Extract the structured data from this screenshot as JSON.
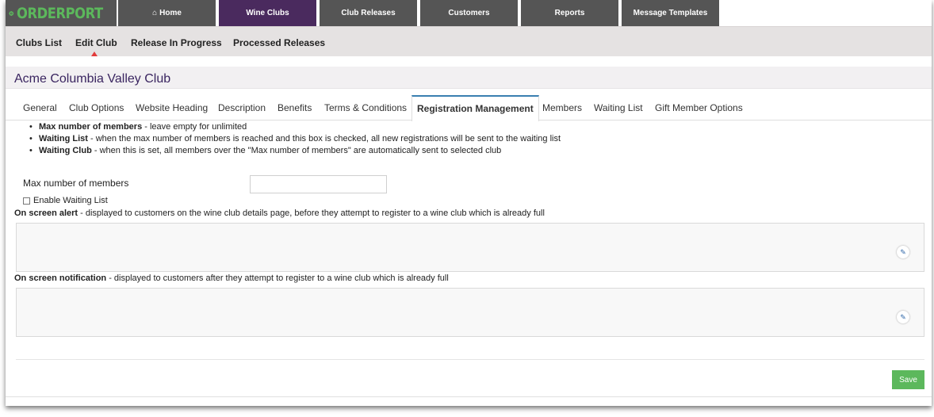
{
  "brand": {
    "name": "ORDERPORT",
    "logo_color": "#5cb85c"
  },
  "topnav": {
    "items": [
      {
        "label": "Home",
        "icon": "home-icon"
      },
      {
        "label": "Wine Clubs"
      },
      {
        "label": "Club Releases"
      },
      {
        "label": "Customers"
      },
      {
        "label": "Reports"
      },
      {
        "label": "Message Templates"
      }
    ],
    "active": "Wine Clubs",
    "active_color": "#4a2a5e"
  },
  "subnav": {
    "items": [
      "Clubs List",
      "Edit Club",
      "Release In Progress",
      "Processed Releases"
    ],
    "active": "Edit Club"
  },
  "page_title": "Acme Columbia Valley Club",
  "tabs": {
    "items": [
      "General",
      "Club Options",
      "Website Heading",
      "Description",
      "Benefits",
      "Terms & Conditions",
      "Registration Management",
      "Members",
      "Waiting List",
      "Gift Member Options"
    ],
    "active": "Registration Management"
  },
  "help": [
    {
      "term": "Max number of members",
      "text": " - leave empty for unlimited"
    },
    {
      "term": "Waiting List",
      "text": " - when the max number of members is reached and this box is checked, all new registrations will be sent to the waiting list"
    },
    {
      "term": "Waiting Club",
      "text": " - when this is set, all members over the \"Max number of members\" are automatically sent to selected club"
    }
  ],
  "form": {
    "max_members_label": "Max number of members",
    "max_members_value": "",
    "enable_waiting_list_label": "Enable Waiting List",
    "enable_waiting_list_checked": false,
    "alert_term": "On screen alert",
    "alert_text": " - displayed to customers on the wine club details page, before they attempt to register to a wine club which is already full",
    "notification_term": "On screen notification",
    "notification_text": " - displayed to customers after they attempt to register to a wine club which is already full",
    "save_label": "Save",
    "save_color": "#5cb85c"
  }
}
